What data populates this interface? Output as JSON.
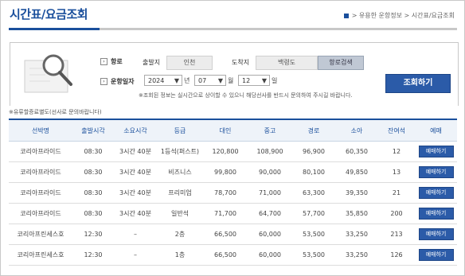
{
  "page": {
    "title": "시간표/요금조회"
  },
  "breadcrumb": "> 유용한 운항정보 > 시간표/요금조회",
  "search": {
    "route_label": "항로",
    "depart_label": "출발지",
    "depart_value": "인천",
    "arrive_label": "도착지",
    "arrive_value": "백령도",
    "route_search_button": "항로검색",
    "date_label": "운항일자",
    "year": "2024",
    "year_unit": "년",
    "month": "07",
    "month_unit": "월",
    "day": "12",
    "day_unit": "일",
    "query_button": "조회하기",
    "notice": "※조회된 정보는 실시간으로 상이할 수 있으니 해당선사를 반드시 문의하여 주시길 바랍니다."
  },
  "fee_note": "※유류할증료별도(선사로 문의바랍니다)",
  "table": {
    "headers": [
      "선박명",
      "출발시각",
      "소요시각",
      "등급",
      "대인",
      "중고",
      "경로",
      "소아",
      "잔여석",
      "예매"
    ],
    "rows": [
      [
        "코리아프라이드",
        "08:30",
        "3시간 40분",
        "1등석(퍼스트)",
        "120,800",
        "108,900",
        "96,900",
        "60,350",
        "12",
        "예매하기"
      ],
      [
        "코리아프라이드",
        "08:30",
        "3시간 40분",
        "비즈니스",
        "99,800",
        "90,000",
        "80,100",
        "49,850",
        "13",
        "예매하기"
      ],
      [
        "코리아프라이드",
        "08:30",
        "3시간 40분",
        "프리미엄",
        "78,700",
        "71,000",
        "63,300",
        "39,350",
        "21",
        "예매하기"
      ],
      [
        "코리아프라이드",
        "08:30",
        "3시간 40분",
        "일반석",
        "71,700",
        "64,700",
        "57,700",
        "35,850",
        "200",
        "예매하기"
      ],
      [
        "코리아프린세스호",
        "12:30",
        "–",
        "2층",
        "66,500",
        "60,000",
        "53,500",
        "33,250",
        "213",
        "예매하기"
      ],
      [
        "코리아프린세스호",
        "12:30",
        "–",
        "1층",
        "66,500",
        "60,000",
        "53,500",
        "33,250",
        "126",
        "예매하기"
      ]
    ]
  }
}
